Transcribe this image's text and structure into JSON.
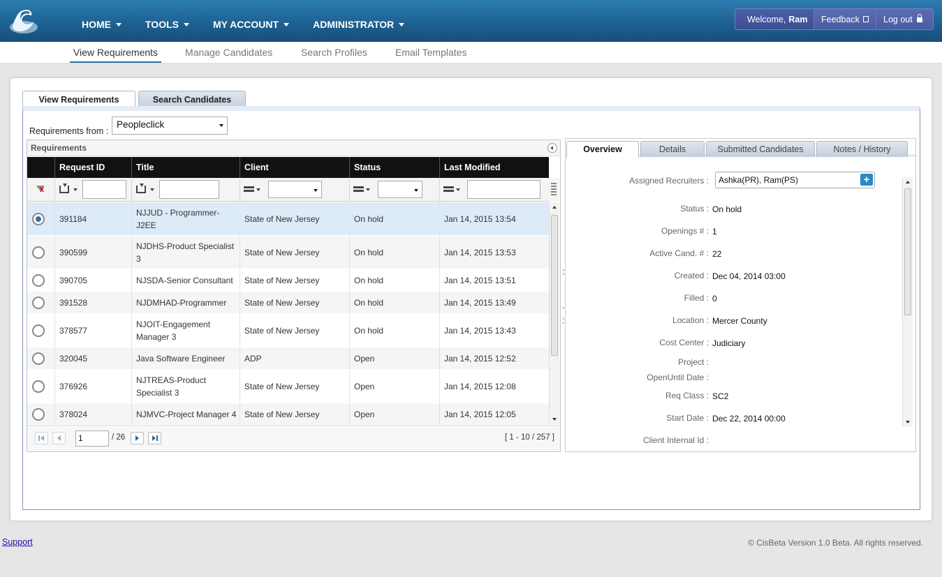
{
  "header": {
    "menus": [
      "HOME",
      "TOOLS",
      "MY ACCOUNT",
      "ADMINISTRATOR"
    ],
    "welcome_label": "Welcome,",
    "user_name": "Ram",
    "feedback_label": "Feedback",
    "logout_label": "Log out"
  },
  "subnav": [
    "View Requirements",
    "Manage Candidates",
    "Search Profiles",
    "Email Templates"
  ],
  "tabs": [
    "View Requirements",
    "Search Candidates"
  ],
  "filter": {
    "label": "Requirements from :",
    "value": "Peopleclick"
  },
  "grid": {
    "title": "Requirements",
    "columns": [
      "Request ID",
      "Title",
      "Client",
      "Status",
      "Last Modified"
    ],
    "rows": [
      {
        "id": "391184",
        "title": "NJJUD - Programmer-J2EE",
        "client": "State of New Jersey",
        "status": "On hold",
        "modified": "Jan 14, 2015 13:54",
        "selected": true
      },
      {
        "id": "390599",
        "title": "NJDHS-Product Specialist 3",
        "client": "State of New Jersey",
        "status": "On hold",
        "modified": "Jan 14, 2015 13:53"
      },
      {
        "id": "390705",
        "title": "NJSDA-Senior Consultant",
        "client": "State of New Jersey",
        "status": "On hold",
        "modified": "Jan 14, 2015 13:51"
      },
      {
        "id": "391528",
        "title": "NJDMHAD-Programmer",
        "client": "State of New Jersey",
        "status": "On hold",
        "modified": "Jan 14, 2015 13:49"
      },
      {
        "id": "378577",
        "title": "NJOIT-Engagement Manager 3",
        "client": "State of New Jersey",
        "status": "On hold",
        "modified": "Jan 14, 2015 13:43"
      },
      {
        "id": "320045",
        "title": "Java Software Engineer",
        "client": "ADP",
        "status": "Open",
        "modified": "Jan 14, 2015 12:52"
      },
      {
        "id": "376926",
        "title": "NJTREAS-Product Specialist 3",
        "client": "State of New Jersey",
        "status": "Open",
        "modified": "Jan 14, 2015 12:08"
      },
      {
        "id": "378024",
        "title": "NJMVC-Project Manager 4",
        "client": "State of New Jersey",
        "status": "Open",
        "modified": "Jan 14, 2015 12:05"
      }
    ],
    "pager": {
      "page": "1",
      "total": "/ 26",
      "info": "[ 1 - 10 / 257 ]"
    }
  },
  "detail": {
    "tabs": [
      "Overview",
      "Details",
      "Submitted Candidates",
      "Notes / History"
    ],
    "assigned_label": "Assigned Recruiters :",
    "assigned_value": "Ashka(PR), Ram(PS)",
    "fields": [
      {
        "label": "Status :",
        "value": "On hold"
      },
      {
        "label": "Openings # :",
        "value": "1"
      },
      {
        "label": "Active Cand. # :",
        "value": "22"
      },
      {
        "label": "Created :",
        "value": "Dec 04, 2014 03:00"
      },
      {
        "label": "Filled :",
        "value": "0"
      },
      {
        "label": "Location :",
        "value": "Mercer County"
      },
      {
        "label": "Cost Center :",
        "value": "Judiciary"
      },
      {
        "label": "Project :",
        "value": ""
      },
      {
        "label": "OpenUntil Date :",
        "value": ""
      },
      {
        "label": "Req Class :",
        "value": "SC2"
      },
      {
        "label": "Start Date :",
        "value": "Dec 22, 2014 00:00"
      },
      {
        "label": "Client Internal Id :",
        "value": ""
      }
    ]
  },
  "footer": {
    "support": "Support",
    "copyright": "© CisBeta Version 1.0 Beta. All rights reserved."
  },
  "colors": {
    "header": "#1d5f8f",
    "accent": "#2a6fa4",
    "selected_row": "#dcebf7"
  },
  "icons": [
    "logo-icon",
    "caret-down-icon",
    "external-link-icon",
    "lock-icon",
    "clear-filter-icon",
    "radio-icon",
    "plus-icon",
    "collapse-icon"
  ]
}
